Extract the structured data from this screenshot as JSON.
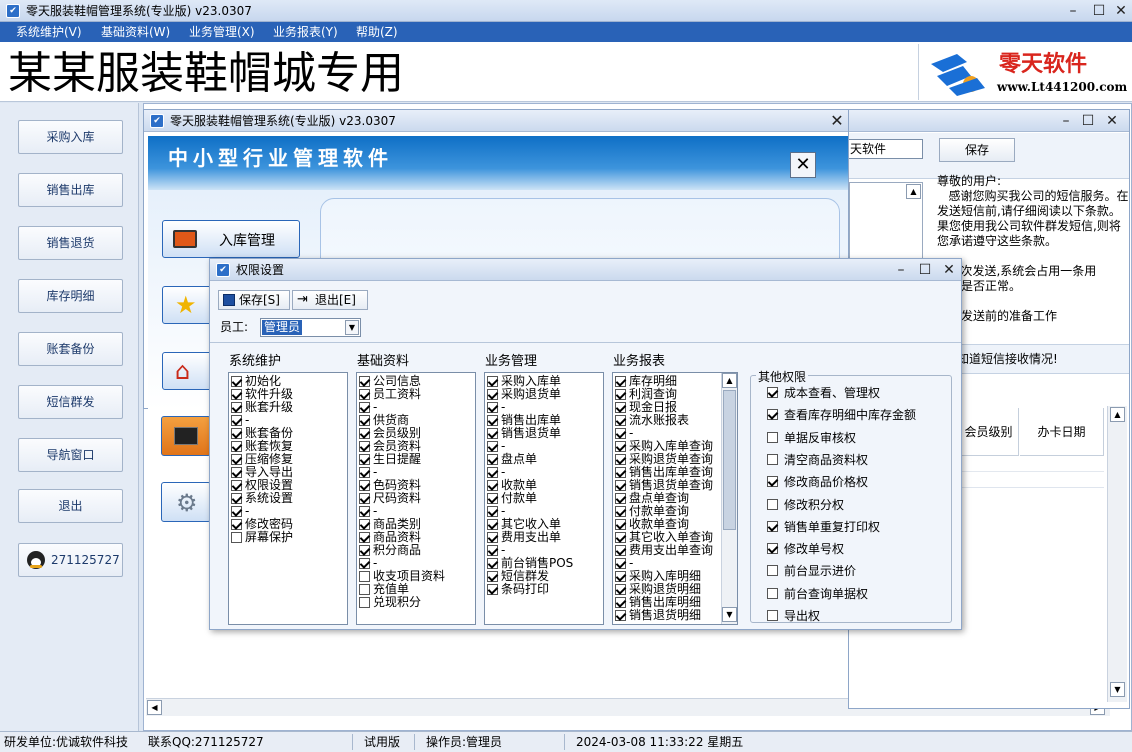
{
  "app": {
    "title": "零天服装鞋帽管理系统(专业版)  v23.0307",
    "banner_title": "某某服装鞋帽城专用",
    "logo_text": "零天软件",
    "logo_url": "www.Lt441200.com"
  },
  "menu": [
    "系统维护(V)",
    "基础资料(W)",
    "业务管理(X)",
    "业务报表(Y)",
    "帮助(Z)"
  ],
  "sidebar": [
    "采购入库",
    "销售出库",
    "销售退货",
    "库存明细",
    "账套备份",
    "短信群发",
    "导航窗口",
    "退出"
  ],
  "qq_button": "271125727",
  "nav_window": {
    "title": "零天服装鞋帽管理系统(专业版) v23.0307",
    "header": "中小型行业管理软件",
    "menu_button": "入库管理"
  },
  "sms_window": {
    "input_value": "天软件",
    "save": "保存",
    "message": [
      "尊敬的用户:",
      "   感谢您购买我公司的短信服务。在",
      "发送短信前,请仔细阅读以下条款。",
      "果您使用我公司软件群发短信,则将",
      "您承诺遵守这些条款。",
      "",
      "   每次发送,系统会占用一条用",
      "通信是否正常。",
      "",
      "短信发送前的准备工作"
    ],
    "bottom_text": "知道短信接收情况!",
    "table_headers": [
      "会员级别",
      "办卡日期"
    ]
  },
  "perm_window": {
    "title": "权限设置",
    "save": "保存[S]",
    "exit": "退出[E]",
    "employee_label": "员工:",
    "employee_value": "管理员",
    "columns": [
      {
        "title": "系统维护",
        "items": [
          {
            "t": "初始化",
            "c": true
          },
          {
            "t": "软件升级",
            "c": true
          },
          {
            "t": "账套升级",
            "c": true
          },
          {
            "t": "-",
            "c": true
          },
          {
            "t": "账套备份",
            "c": true
          },
          {
            "t": "账套恢复",
            "c": true
          },
          {
            "t": "压缩修复",
            "c": true
          },
          {
            "t": "导入导出",
            "c": true
          },
          {
            "t": "权限设置",
            "c": true
          },
          {
            "t": "系统设置",
            "c": true
          },
          {
            "t": "-",
            "c": true
          },
          {
            "t": "修改密码",
            "c": true
          },
          {
            "t": "屏幕保护",
            "c": false
          }
        ]
      },
      {
        "title": "基础资料",
        "items": [
          {
            "t": "公司信息",
            "c": true
          },
          {
            "t": "员工资料",
            "c": true
          },
          {
            "t": "-",
            "c": true
          },
          {
            "t": "供货商",
            "c": true
          },
          {
            "t": "会员级别",
            "c": true
          },
          {
            "t": "会员资料",
            "c": true
          },
          {
            "t": "生日提醒",
            "c": true
          },
          {
            "t": "-",
            "c": true
          },
          {
            "t": "色码资料",
            "c": true
          },
          {
            "t": "尺码资料",
            "c": true
          },
          {
            "t": "-",
            "c": true
          },
          {
            "t": "商品类别",
            "c": true
          },
          {
            "t": "商品资料",
            "c": true
          },
          {
            "t": "积分商品",
            "c": true
          },
          {
            "t": "-",
            "c": true
          },
          {
            "t": "收支项目资料",
            "c": false
          },
          {
            "t": "充值单",
            "c": false
          },
          {
            "t": "兑现积分",
            "c": false
          }
        ]
      },
      {
        "title": "业务管理",
        "items": [
          {
            "t": "采购入库单",
            "c": true
          },
          {
            "t": "采购退货单",
            "c": true
          },
          {
            "t": "-",
            "c": true
          },
          {
            "t": "销售出库单",
            "c": true
          },
          {
            "t": "销售退货单",
            "c": true
          },
          {
            "t": "-",
            "c": true
          },
          {
            "t": "盘点单",
            "c": true
          },
          {
            "t": "-",
            "c": true
          },
          {
            "t": "收款单",
            "c": true
          },
          {
            "t": "付款单",
            "c": true
          },
          {
            "t": "-",
            "c": true
          },
          {
            "t": "其它收入单",
            "c": true
          },
          {
            "t": "费用支出单",
            "c": true
          },
          {
            "t": "-",
            "c": true
          },
          {
            "t": "前台销售POS",
            "c": true
          },
          {
            "t": "短信群发",
            "c": true
          },
          {
            "t": "条码打印",
            "c": true
          }
        ]
      },
      {
        "title": "业务报表",
        "items": [
          {
            "t": "库存明细",
            "c": true
          },
          {
            "t": "利润查询",
            "c": true
          },
          {
            "t": "现金日报",
            "c": true
          },
          {
            "t": "流水账报表",
            "c": true
          },
          {
            "t": "-",
            "c": true
          },
          {
            "t": "采购入库单查询",
            "c": true
          },
          {
            "t": "采购退货单查询",
            "c": true
          },
          {
            "t": "销售出库单查询",
            "c": true
          },
          {
            "t": "销售退货单查询",
            "c": true
          },
          {
            "t": "盘点单查询",
            "c": true
          },
          {
            "t": "付款单查询",
            "c": true
          },
          {
            "t": "收款单查询",
            "c": true
          },
          {
            "t": "其它收入单查询",
            "c": true
          },
          {
            "t": "费用支出单查询",
            "c": true
          },
          {
            "t": "-",
            "c": true
          },
          {
            "t": "采购入库明细",
            "c": true
          },
          {
            "t": "采购退货明细",
            "c": true
          },
          {
            "t": "销售出库明细",
            "c": true
          },
          {
            "t": "销售退货明细",
            "c": true
          }
        ]
      }
    ],
    "other_title": "其他权限",
    "other": [
      {
        "t": "成本查看、管理权",
        "c": true
      },
      {
        "t": "查看库存明细中库存金额",
        "c": true
      },
      {
        "t": "单据反审核权",
        "c": false
      },
      {
        "t": "清空商品资料权",
        "c": false
      },
      {
        "t": "修改商品价格权",
        "c": true
      },
      {
        "t": "修改积分权",
        "c": false
      },
      {
        "t": "销售单重复打印权",
        "c": true
      },
      {
        "t": "修改单号权",
        "c": true
      },
      {
        "t": "前台显示进价",
        "c": false
      },
      {
        "t": "前台查询单据权",
        "c": false
      },
      {
        "t": "导出权",
        "c": false
      }
    ]
  },
  "status": {
    "developer": "研发单位:优诚软件科技",
    "qq": "联系QQ:271125727",
    "version": "试用版",
    "operator": "操作员:管理员",
    "datetime": "2024-03-08 11:33:22 星期五"
  }
}
